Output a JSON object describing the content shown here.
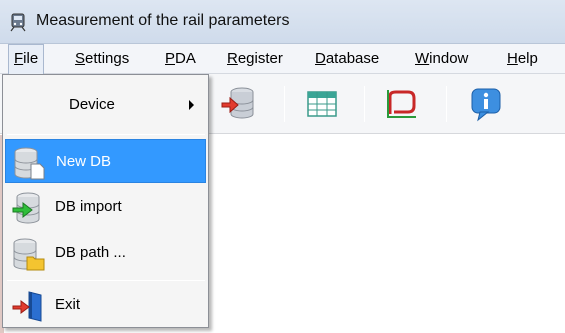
{
  "window": {
    "title": "Measurement of the rail parameters",
    "app_icon": "train-icon"
  },
  "menubar": {
    "items": [
      {
        "first": "F",
        "rest": "ile"
      },
      {
        "first": "S",
        "rest": "ettings"
      },
      {
        "first": "P",
        "rest": "DA"
      },
      {
        "first": "R",
        "rest": "egister"
      },
      {
        "first": "D",
        "rest": "atabase"
      },
      {
        "first": "W",
        "rest": "indow"
      },
      {
        "first": "H",
        "rest": "elp"
      }
    ],
    "active": "File"
  },
  "toolbar": {
    "buttons": [
      "database-export-icon",
      "table-grid-icon",
      "rail-profile-icon",
      "info-icon"
    ]
  },
  "file_menu": {
    "device": {
      "label": "Device",
      "has_submenu": true
    },
    "new_db": {
      "label": "New DB",
      "icon": "new-database-icon",
      "highlighted": true
    },
    "db_import": {
      "label": "DB import",
      "icon": "database-import-icon"
    },
    "db_path": {
      "label": "DB path ...",
      "icon": "database-folder-icon"
    },
    "exit": {
      "label": "Exit",
      "icon": "exit-door-icon"
    }
  },
  "colors": {
    "highlight": "#3399ff",
    "titlebar": "#d6e0ee",
    "menubar": "#f3f5f9"
  }
}
